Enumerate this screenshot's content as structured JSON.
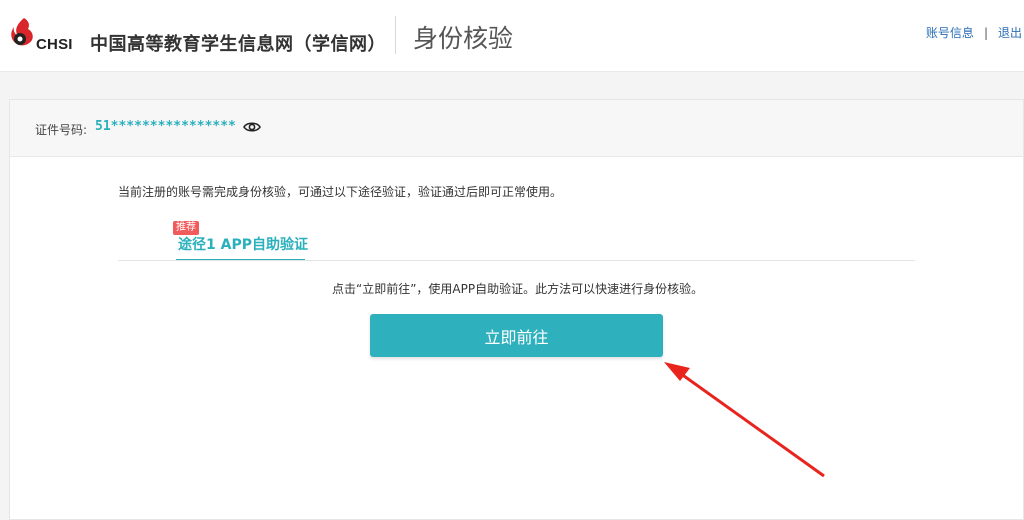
{
  "header": {
    "logo_text": "CHSI",
    "site_name": "中国高等教育学生信息网（学信网）",
    "page_title": "身份核验",
    "links": [
      {
        "label": "账号信息"
      },
      {
        "label": "退出"
      }
    ],
    "separator": "|"
  },
  "id_bar": {
    "label": "证件号码:",
    "value": "51****************"
  },
  "content": {
    "notice": "当前注册的账号需完成身份核验，可通过以下途径验证，验证通过后即可正常使用。",
    "badge": "推荐",
    "tab_label": "途径1 APP自助验证",
    "instruction": "点击“立即前往”，使用APP自助验证。此方法可以快速进行身份核验。",
    "button_label": "立即前往"
  },
  "colors": {
    "accent": "#2fb1bd",
    "link": "#2a6eb5",
    "badge": "#f25b5b",
    "arrow": "#e8241d"
  }
}
